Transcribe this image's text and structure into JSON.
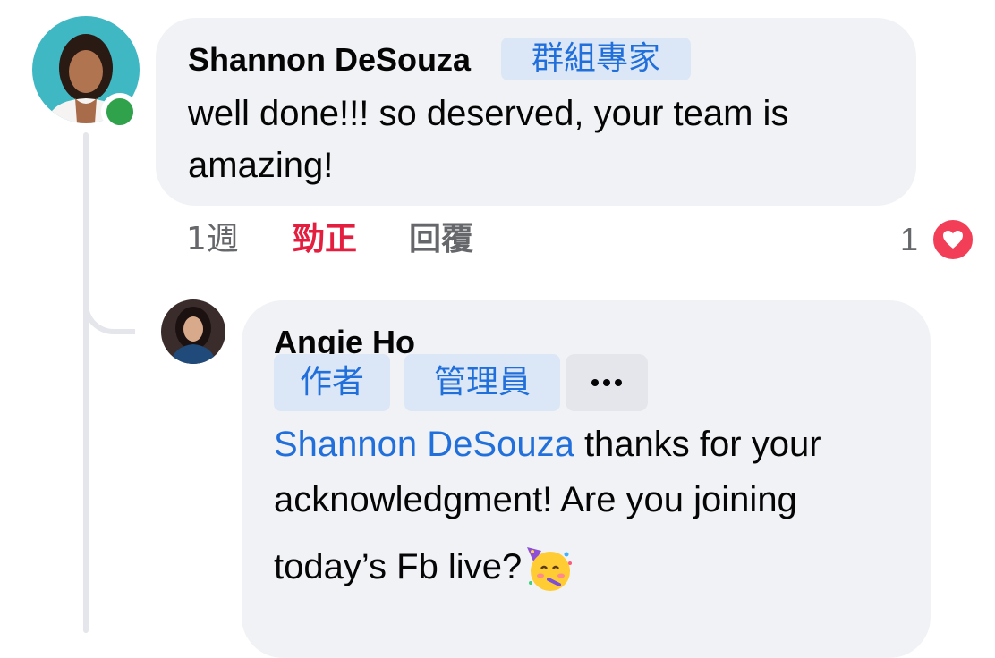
{
  "comment": {
    "author": "Shannon DeSouza",
    "badge": "群組專家",
    "text": "well done!!! so deserved, your team is amazing!",
    "time": "1週",
    "like_label": "勁正",
    "reply_label": "回覆",
    "reaction_count": "1",
    "reaction_icon": "heart-reaction-icon",
    "online_status_color": "#31a24c"
  },
  "reply": {
    "author": "Angie Ho",
    "badges": [
      "作者",
      "管理員"
    ],
    "more_icon": "more-icon",
    "mention": "Shannon DeSouza",
    "text_line1": " thanks for your",
    "text_line2": "acknowledgment! Are you joining",
    "text_line3": "today’s Fb live?",
    "emoji": "partying-face-emoji"
  },
  "colors": {
    "bubble": "#f0f2f5",
    "badge_bg": "#dbe7f6",
    "badge_text": "#216fdb",
    "mention": "#216fdb",
    "like_active": "#e41e3f",
    "heart": "#f33e58"
  }
}
